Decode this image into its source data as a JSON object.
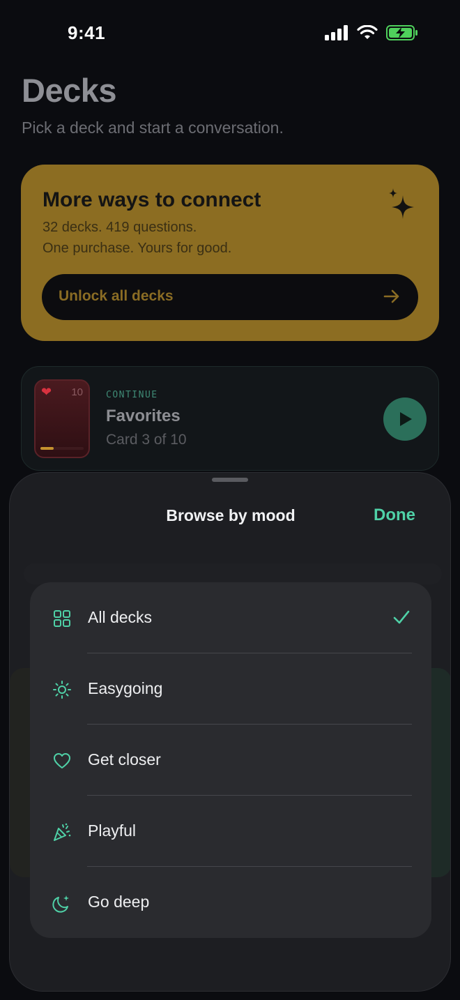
{
  "status_bar": {
    "time": "9:41"
  },
  "header": {
    "title": "Decks",
    "subtitle": "Pick a deck and start a conversation."
  },
  "promo": {
    "title": "More ways to connect",
    "line1": "32 decks. 419 questions.",
    "line2": "One purchase. Yours for good.",
    "button_label": "Unlock all decks",
    "icon": "sparkle-icon"
  },
  "continue_card": {
    "eyebrow": "CONTINUE",
    "deck_name": "Favorites",
    "progress_text": "Card 3 of 10",
    "thumb_count": "10",
    "progress_fraction": 0.3
  },
  "sheet": {
    "title": "Browse by mood",
    "done_label": "Done",
    "items": [
      {
        "label": "All decks",
        "icon": "grid-icon",
        "selected": true
      },
      {
        "label": "Easygoing",
        "icon": "sun-icon",
        "selected": false
      },
      {
        "label": "Get closer",
        "icon": "heart-icon",
        "selected": false
      },
      {
        "label": "Playful",
        "icon": "party-popper-icon",
        "selected": false
      },
      {
        "label": "Go deep",
        "icon": "moon-stars-icon",
        "selected": false
      }
    ]
  },
  "colors": {
    "accent": "#4fd1a7",
    "promo_bg": "#8c6d22",
    "background": "#0b0c10",
    "sheet_bg": "#1d1e22"
  }
}
